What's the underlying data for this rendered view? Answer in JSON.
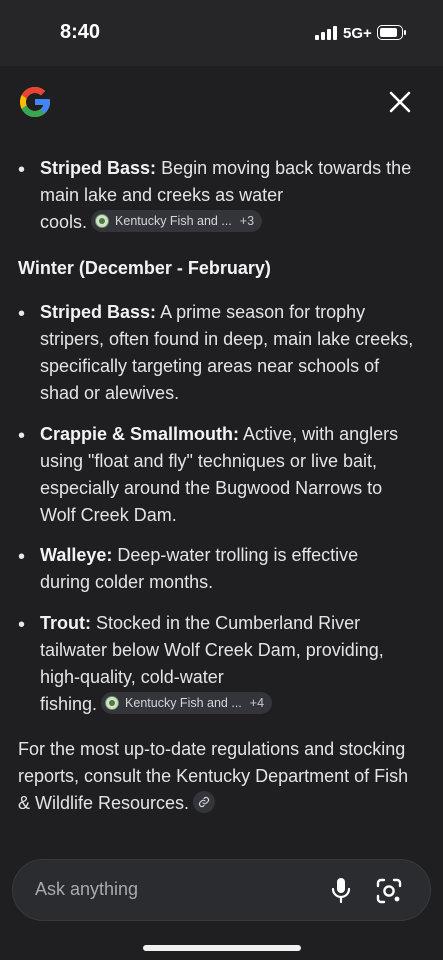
{
  "status_bar": {
    "time": "8:40",
    "network": "5G+"
  },
  "header": {
    "logo": "google-g-logo",
    "close_icon": "close-icon"
  },
  "content": {
    "item1": {
      "label": "Striped Bass:",
      "line1": "Begin moving back towards the",
      "line2": "main lake and creeks as water",
      "line3": "cools.",
      "chip": {
        "text": "Kentucky Fish and ...",
        "count": "+3"
      }
    },
    "heading": "Winter (December - February)",
    "item2": {
      "label": "Striped Bass:",
      "line1": "A prime season for trophy",
      "line2": "stripers, often found in deep, main lake creeks,",
      "line3": "specifically targeting areas near schools of",
      "line4": "shad or alewives."
    },
    "item3": {
      "label": "Crappie & Smallmouth:",
      "line1": "Active, with anglers",
      "line2": "using \"float and fly\" techniques or live bait,",
      "line3": "especially around the Bugwood Narrows to",
      "line4": "Wolf Creek Dam."
    },
    "item4": {
      "label": "Walleye:",
      "line1": "Deep-water trolling is effective",
      "line2": "during colder months."
    },
    "item5": {
      "label": "Trout:",
      "line1": "Stocked in the Cumberland River",
      "line2": "tailwater below Wolf Creek Dam, providing,",
      "line3": "high-quality, cold-water",
      "line4": "fishing.",
      "chip": {
        "text": "Kentucky Fish and ...",
        "count": "+4"
      }
    },
    "closing": {
      "line1": "For the most up-to-date regulations and stocking",
      "line2": "reports, consult the Kentucky Department of Fish",
      "line3": "& Wildlife Resources."
    }
  },
  "ask_bar": {
    "placeholder": "Ask anything"
  },
  "colors": {
    "background": "#1f1f21",
    "status_bar": "#262628",
    "chip_bg": "#34353a",
    "input_bg": "#2b2c30",
    "google_blue": "#4285F4",
    "google_red": "#EA4335",
    "google_yellow": "#FBBC05",
    "google_green": "#34A853"
  }
}
